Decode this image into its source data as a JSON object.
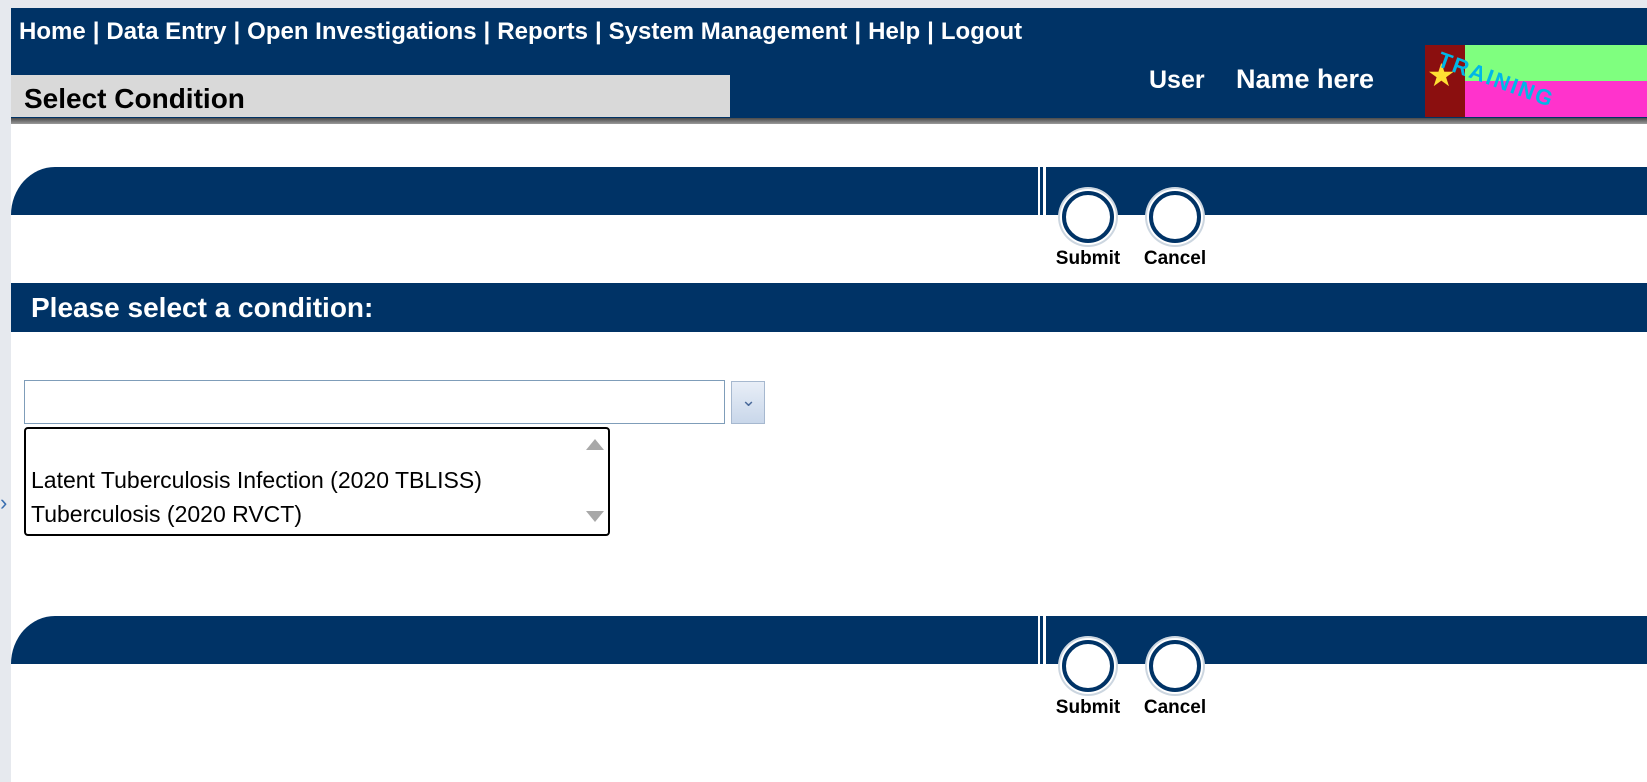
{
  "nav": {
    "items": [
      "Home",
      "Data Entry",
      "Open Investigations",
      "Reports",
      "System Management",
      "Help",
      "Logout"
    ],
    "separator": "|"
  },
  "page": {
    "title": "Select Condition"
  },
  "user": {
    "label": "User",
    "name": "Name here"
  },
  "logo": {
    "text": "TRAINING"
  },
  "buttons": {
    "submit": "Submit",
    "cancel": "Cancel"
  },
  "section": {
    "title": "Please select a condition:"
  },
  "condition_select": {
    "value": "",
    "options": [
      "Latent Tuberculosis Infection (2020 TBLISS)",
      "Tuberculosis (2020 RVCT)"
    ]
  },
  "colors": {
    "primary": "#003366",
    "title_bg": "#d9d9d9"
  }
}
